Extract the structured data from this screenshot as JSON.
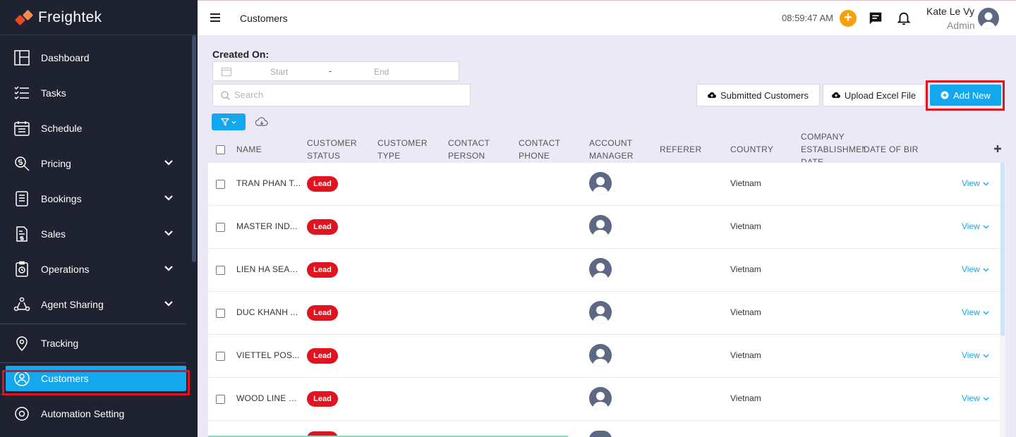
{
  "brand": {
    "name": "Freightek"
  },
  "sidebar": {
    "items": [
      {
        "label": "Dashboard",
        "icon": "dashboard-icon",
        "expandable": false
      },
      {
        "label": "Tasks",
        "icon": "tasks-icon",
        "expandable": false
      },
      {
        "label": "Schedule",
        "icon": "calendar-icon",
        "expandable": false
      },
      {
        "label": "Pricing",
        "icon": "pricing-icon",
        "expandable": true
      },
      {
        "label": "Bookings",
        "icon": "bookings-icon",
        "expandable": true
      },
      {
        "label": "Sales",
        "icon": "sales-icon",
        "expandable": true
      },
      {
        "label": "Operations",
        "icon": "operations-icon",
        "expandable": true
      },
      {
        "label": "Agent Sharing",
        "icon": "agent-sharing-icon",
        "expandable": true
      },
      {
        "label": "Tracking",
        "icon": "location-pin-icon",
        "expandable": false
      },
      {
        "label": "Customers",
        "icon": "customers-icon",
        "expandable": false,
        "active": true
      },
      {
        "label": "Automation Setting",
        "icon": "gear-icon",
        "expandable": false
      }
    ]
  },
  "header": {
    "title": "Customers",
    "time": "08:59:47 AM",
    "plus_label": "+",
    "user_name": "Kate Le Vy",
    "user_role": "Admin"
  },
  "filters": {
    "created_on_label": "Created On:",
    "start_placeholder": "Start",
    "range_separator": "-",
    "end_placeholder": "End",
    "search_placeholder": "Search"
  },
  "actions": {
    "submitted_label": "Submitted Customers",
    "upload_label": "Upload Excel File",
    "add_label": "Add New"
  },
  "table": {
    "columns": [
      {
        "label": "NAME"
      },
      {
        "label": "CUSTOMER STATUS"
      },
      {
        "label": "CUSTOMER TYPE"
      },
      {
        "label": "CONTACT PERSON"
      },
      {
        "label": "CONTACT PHONE"
      },
      {
        "label": "ACCOUNT MANAGER"
      },
      {
        "label": "REFERER"
      },
      {
        "label": "COUNTRY"
      },
      {
        "label": "COMPANY ESTABLISHMENT DATE"
      },
      {
        "label": "DATE OF BIR"
      }
    ],
    "rows": [
      {
        "name": "TRAN PHAN T...",
        "status": "Lead",
        "country": "Vietnam",
        "action": "View"
      },
      {
        "name": "MASTER IND...",
        "status": "Lead",
        "country": "Vietnam",
        "action": "View"
      },
      {
        "name": "LIEN HA SEAF...",
        "status": "Lead",
        "country": "Vietnam",
        "action": "View"
      },
      {
        "name": "DUC KHANH ...",
        "status": "Lead",
        "country": "Vietnam",
        "action": "View"
      },
      {
        "name": "VIETTEL POS...",
        "status": "Lead",
        "country": "Vietnam",
        "action": "View"
      },
      {
        "name": "WOOD LINE C...",
        "status": "Lead",
        "country": "Vietnam",
        "action": "View"
      }
    ]
  },
  "colors": {
    "sidebar_bg": "#1f2331",
    "accent": "#13a8ee",
    "lead_badge": "#e0141e",
    "highlight_outline": "#e0141e",
    "page_bg": "#eae9f5"
  }
}
